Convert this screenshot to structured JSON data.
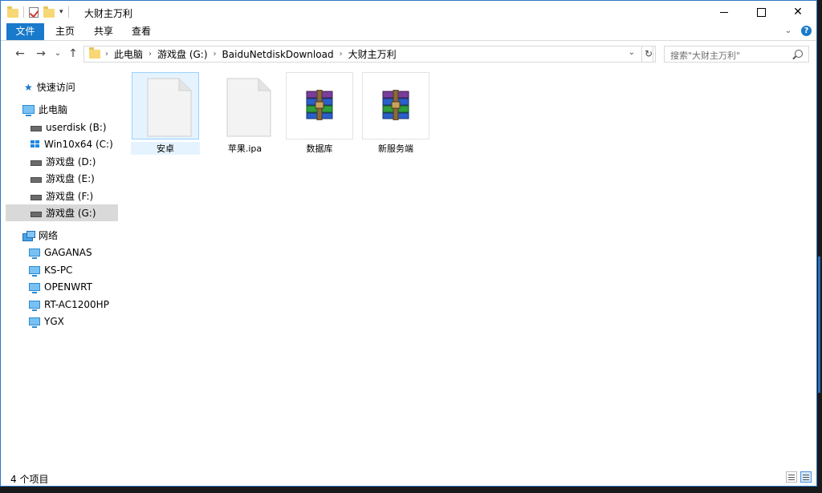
{
  "window": {
    "title": "大财主万利"
  },
  "ribbon": {
    "tabs": [
      {
        "label": "文件"
      },
      {
        "label": "主页"
      },
      {
        "label": "共享"
      },
      {
        "label": "查看"
      }
    ]
  },
  "address": {
    "crumbs": [
      "此电脑",
      "游戏盘 (G:)",
      "BaiduNetdiskDownload",
      "大财主万利"
    ]
  },
  "search": {
    "placeholder": "搜索\"大财主万利\""
  },
  "sidebar": {
    "items": [
      {
        "label": "快速访问",
        "icon": "star-icon"
      },
      {
        "label": "此电脑",
        "icon": "pc-icon"
      },
      {
        "label": "userdisk (B:)",
        "icon": "drive-icon"
      },
      {
        "label": "Win10x64 (C:)",
        "icon": "windows-drive-icon"
      },
      {
        "label": "游戏盘 (D:)",
        "icon": "drive-icon"
      },
      {
        "label": "游戏盘 (E:)",
        "icon": "drive-icon"
      },
      {
        "label": "游戏盘 (F:)",
        "icon": "drive-icon"
      },
      {
        "label": "游戏盘 (G:)",
        "icon": "drive-icon",
        "selected": true
      },
      {
        "label": "网络",
        "icon": "network-icon"
      },
      {
        "label": "GAGANAS",
        "icon": "computer-icon"
      },
      {
        "label": "KS-PC",
        "icon": "computer-icon"
      },
      {
        "label": "OPENWRT",
        "icon": "computer-icon"
      },
      {
        "label": "RT-AC1200HP",
        "icon": "computer-icon"
      },
      {
        "label": "YGX",
        "icon": "computer-icon"
      }
    ]
  },
  "files": [
    {
      "name": "安卓",
      "icon": "blank-file-icon",
      "selected": true
    },
    {
      "name": "苹果.ipa",
      "icon": "blank-file-icon"
    },
    {
      "name": "数据库",
      "icon": "rar-archive-icon"
    },
    {
      "name": "新服务端",
      "icon": "rar-archive-icon"
    }
  ],
  "status": {
    "item_count": "4 个项目"
  }
}
